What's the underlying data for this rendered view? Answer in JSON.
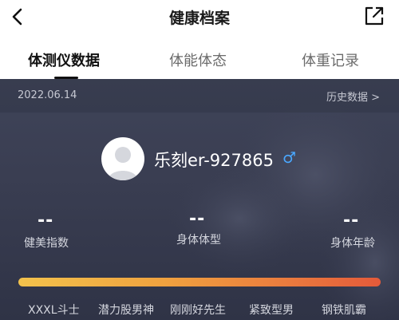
{
  "header": {
    "title": "健康档案",
    "back_icon": "chevron-left-icon",
    "share_icon": "external-link-icon"
  },
  "tabs": [
    {
      "label": "体测仪数据",
      "active": true
    },
    {
      "label": "体能体态",
      "active": false
    },
    {
      "label": "体重记录",
      "active": false
    }
  ],
  "record": {
    "date": "2022.06.14",
    "history_label": "历史数据 >"
  },
  "profile": {
    "username": "乐刻er-927865",
    "gender_symbol": "♂",
    "gender_color": "#4aa8ff"
  },
  "metrics": [
    {
      "value": "--",
      "label": "健美指数"
    },
    {
      "value": "--",
      "label": "身体体型"
    },
    {
      "value": "--",
      "label": "身体年龄"
    }
  ],
  "levels": [
    "XXXL斗士",
    "潜力股男神",
    "刚刚好先生",
    "紧致型男",
    "钢铁肌霸"
  ],
  "colors": {
    "panel_bg": "#3a3e52",
    "bar_start": "#f2c24c",
    "bar_end": "#e45a3a"
  }
}
